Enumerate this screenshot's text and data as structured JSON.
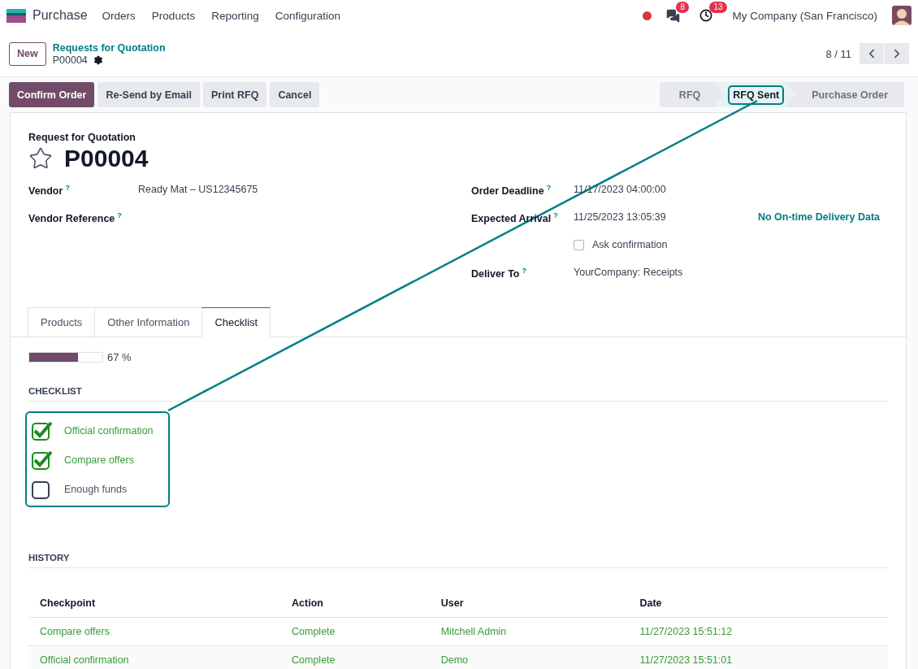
{
  "navbar": {
    "app_name": "Purchase",
    "menu": [
      "Orders",
      "Products",
      "Reporting",
      "Configuration"
    ],
    "chat_count": "8",
    "activity_count": "13",
    "company": "My Company (San Francisco)"
  },
  "control_panel": {
    "new_button": "New",
    "breadcrumb": "Requests for Quotation",
    "record": "P00004",
    "pager": "8 / 11"
  },
  "actions": [
    {
      "label": "Confirm Order",
      "kind": "primary"
    },
    {
      "label": "Re-Send by Email",
      "kind": "secondary"
    },
    {
      "label": "Print RFQ",
      "kind": "secondary"
    },
    {
      "label": "Cancel",
      "kind": "secondary"
    }
  ],
  "stages": [
    {
      "label": "RFQ",
      "selected": false
    },
    {
      "label": "RFQ Sent",
      "selected": true
    },
    {
      "label": "Purchase Order",
      "selected": false
    }
  ],
  "form": {
    "subtitle": "Request for Quotation",
    "favorite": false,
    "title": "P00004",
    "left_fields": [
      {
        "kind": "field",
        "label": "Vendor",
        "help": "?",
        "value": "Ready Mat – US12345675"
      },
      {
        "kind": "field",
        "label": "Vendor Reference",
        "help": "?"
      }
    ],
    "right_fields": [
      {
        "kind": "field",
        "label": "Order Deadline",
        "help": "?",
        "value": "11/17/2023 04:00:00"
      },
      {
        "kind": "field",
        "label": "Expected Arrival",
        "help": "?",
        "value": "11/25/2023 13:05:39",
        "note": "No On-time Delivery Data"
      },
      {
        "kind": "checkbox",
        "label": "Ask confirmation",
        "checked": false
      },
      {
        "kind": "field",
        "label": "Deliver To",
        "help": "?",
        "value": "YourCompany: Receipts"
      }
    ]
  },
  "tabs": [
    {
      "label": "Products",
      "selected": false
    },
    {
      "label": "Other Information",
      "selected": false
    },
    {
      "label": "Checklist",
      "selected": true
    }
  ],
  "progress": {
    "level": 0.67,
    "reading": "67 %"
  },
  "checklist": {
    "heading": "CHECKLIST",
    "items": [
      {
        "label": "Official confirmation",
        "checked": true
      },
      {
        "label": "Compare offers",
        "checked": true
      },
      {
        "label": "Enough funds",
        "checked": false
      }
    ]
  },
  "history": {
    "heading": "HISTORY",
    "columns": [
      "Checkpoint",
      "Action",
      "User",
      "Date"
    ],
    "rows": [
      [
        "Compare offers",
        "Complete",
        "Mitchell Admin",
        "11/27/2023 15:51:12"
      ],
      [
        "Official confirmation",
        "Complete",
        "Demo",
        "11/27/2023 15:51:01"
      ]
    ]
  }
}
